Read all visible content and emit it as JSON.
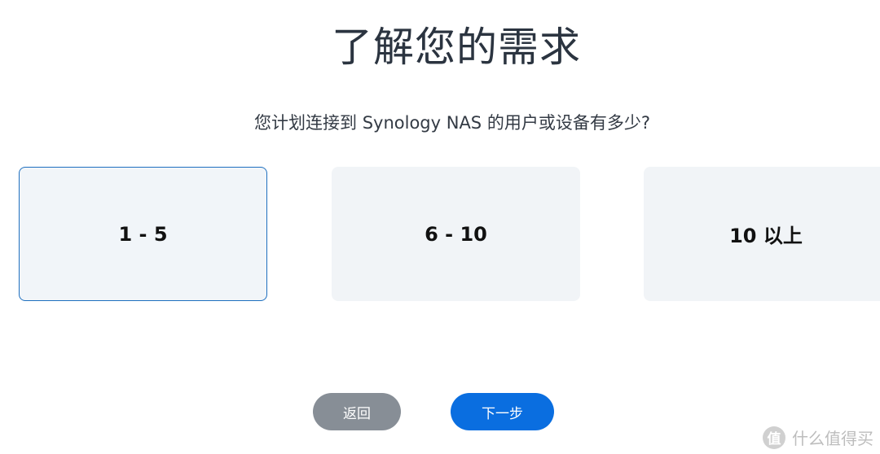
{
  "header": {
    "title": "了解您的需求",
    "question": "您计划连接到 Synology NAS 的用户或设备有多少?"
  },
  "options": [
    {
      "label": "1 - 5",
      "selected": true
    },
    {
      "label": "6 - 10",
      "selected": false
    },
    {
      "label": "10 以上",
      "selected": false
    }
  ],
  "footer": {
    "back_label": "返回",
    "next_label": "下一步"
  },
  "watermark": {
    "logo_char": "值",
    "text": "什么值得买"
  },
  "colors": {
    "selected_border": "#1e6fbf",
    "card_bg": "#f1f4f7",
    "back_button": "#878e96",
    "next_button": "#0a6ee0"
  }
}
